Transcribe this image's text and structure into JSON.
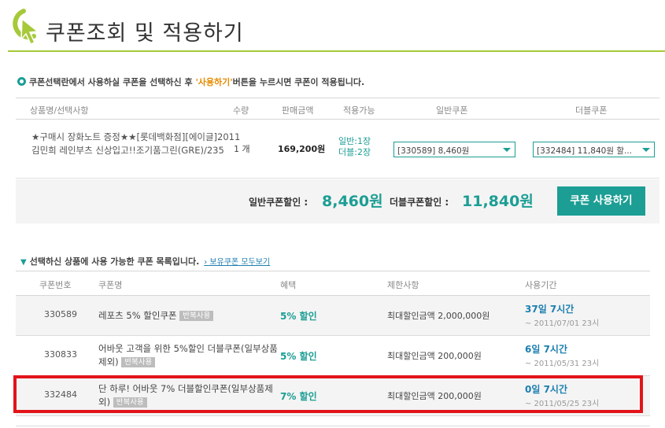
{
  "header": {
    "title": "쿠폰조회 및 적용하기"
  },
  "notice": {
    "prefix": "쿠폰선택란에서 사용하실 쿠폰을 선택하신 후 ",
    "highlight": "'사용하기'",
    "suffix": "버튼을 누르시면 쿠폰이 적용됩니다."
  },
  "order_table": {
    "headers": [
      "상품명/선택사항",
      "수량",
      "판매금액",
      "적용가능",
      "일반쿠폰",
      "더블쿠폰"
    ],
    "row": {
      "product": "★구매시 장화노트 증정★★[롯데백화점][에이글]2011 김민희 레인부츠 신상입고!!조기품그린(GRE)/235",
      "quantity": "1 개",
      "price": "169,200원",
      "available_general": "일반:1장",
      "available_double": "더블:2장",
      "general_coupon": "[330589] 8,460원",
      "double_coupon": "[332484] 11,840원 할..."
    },
    "summary": {
      "general_label": "일반쿠폰할인 :",
      "general_value": "8,460원",
      "double_label": "더블쿠폰할인 :",
      "double_value": "11,840원",
      "apply_button": "쿠폰 사용하기"
    }
  },
  "coupon_list": {
    "title": "선택하신 상품에 사용 가능한 쿠폰 목록입니다.",
    "link": "보유쿠폰 모두보기",
    "headers": [
      "쿠폰번호",
      "쿠폰명",
      "혜택",
      "제한사항",
      "사용기간"
    ],
    "rows": [
      {
        "number": "330589",
        "name": "레포츠 5% 할인쿠폰",
        "badge": "반복사용",
        "benefit": "5% 할인",
        "limit": "최대할인금액 2,000,000원",
        "period": "37일 7시간",
        "date": "~ 2011/07/01 23시"
      },
      {
        "number": "330833",
        "name": "어바웃 고객을 위한 5%할인 더블쿠폰(일부상품제외)",
        "badge": "반복사용",
        "benefit": "5% 할인",
        "limit": "최대할인금액 200,000원",
        "period": "6일 7시간",
        "date": "~ 2011/05/31 23시"
      },
      {
        "number": "332484",
        "name": "단 하루! 어바웃 7% 더블할인쿠폰(일부상품제외)",
        "badge": "반복사용",
        "benefit": "7% 할인",
        "limit": "최대할인금액 200,000원",
        "period": "0일 7시간",
        "date": "~ 2011/05/25 23시"
      }
    ]
  },
  "colors": {
    "accent": "#1c9e94",
    "highlight": "#e58a00",
    "header_line": "#a6c93a",
    "selection_box": "#e2141a"
  }
}
